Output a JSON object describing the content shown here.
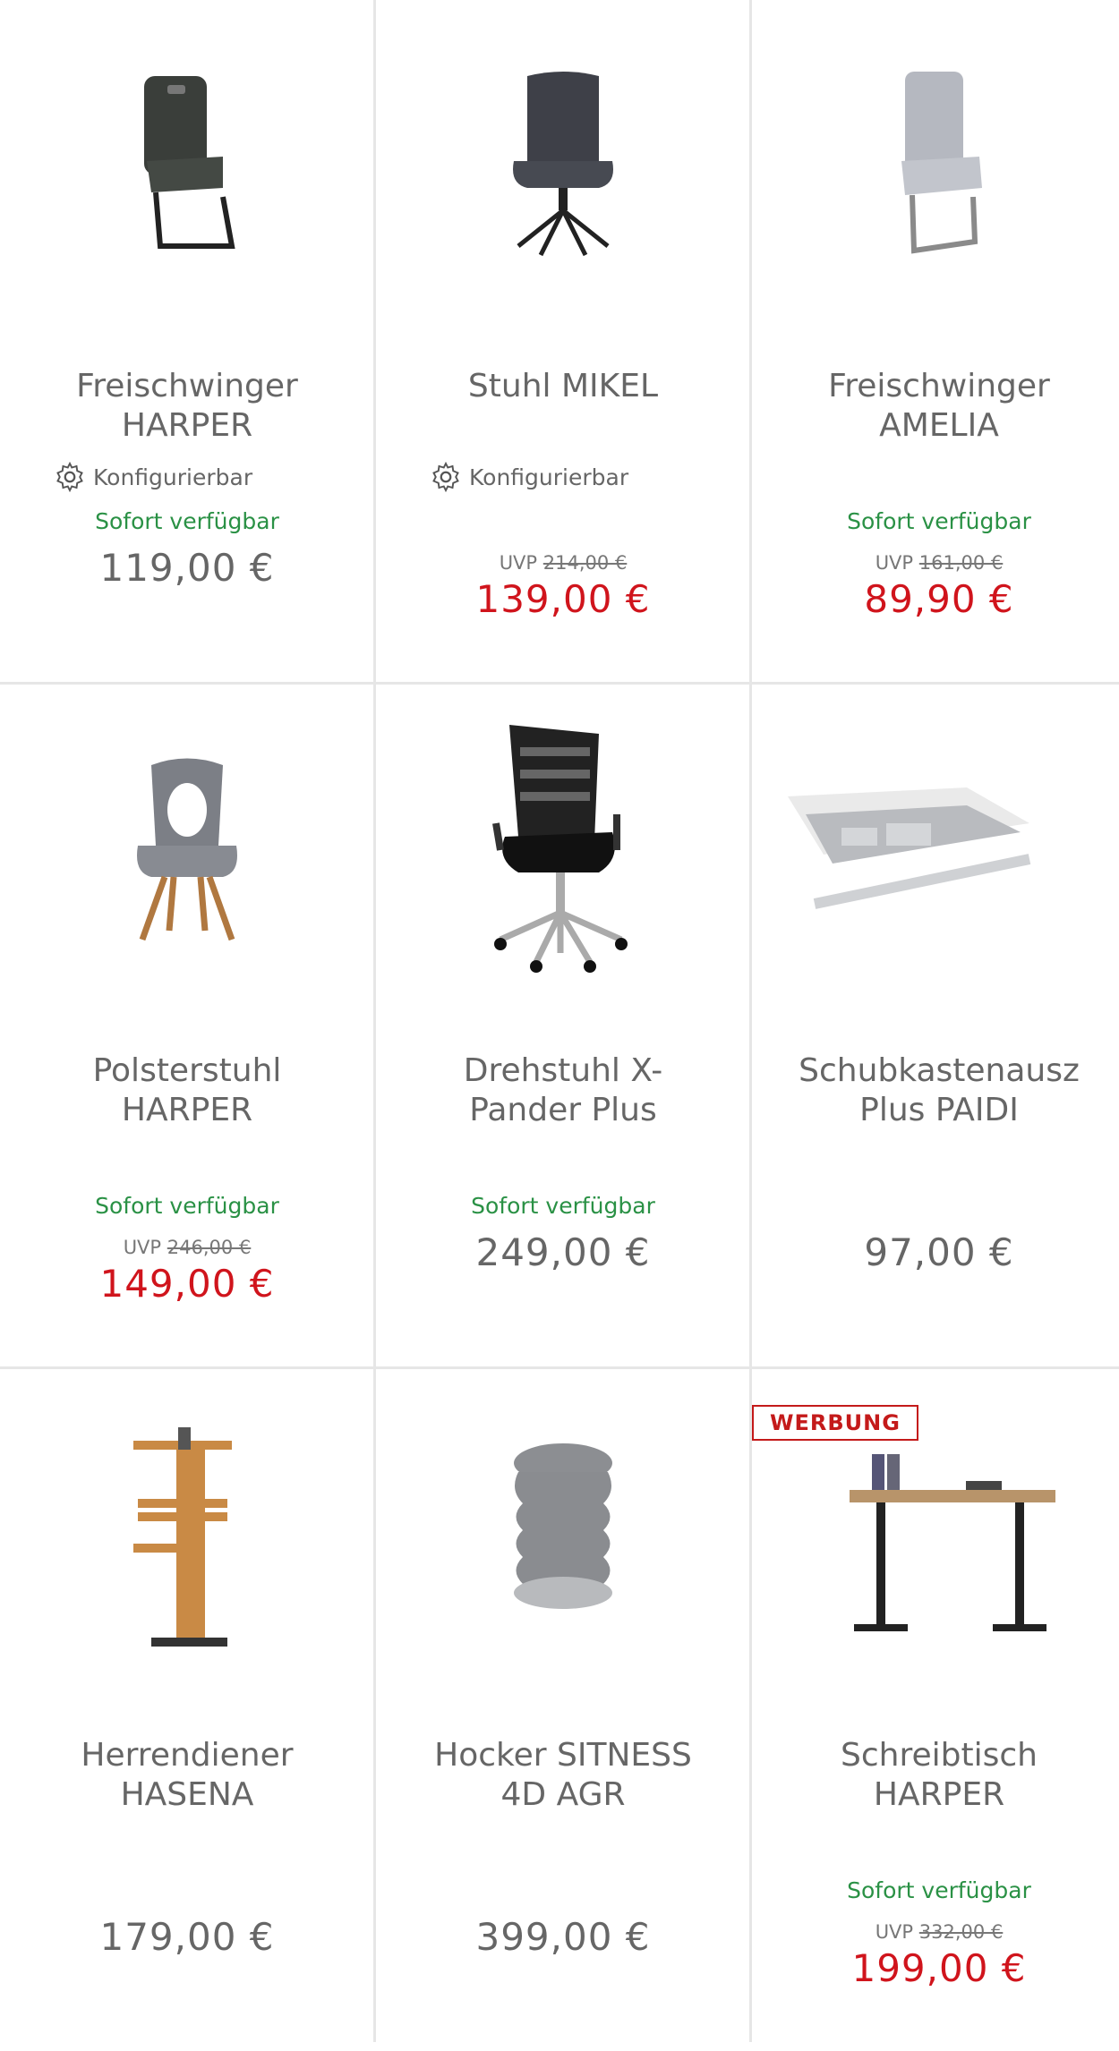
{
  "products": [
    {
      "name": "Freischwinger\nHARPER",
      "configurable": "Konfigurierbar",
      "availability": "Sofort verfügbar",
      "uvp_label": "",
      "uvp_price": "",
      "price": "119,00 €",
      "sale": false
    },
    {
      "name": "Stuhl MIKEL",
      "configurable": "Konfigurierbar",
      "availability": "",
      "uvp_label": "UVP",
      "uvp_price": "214,00 €",
      "price": "139,00 €",
      "sale": true
    },
    {
      "name": "Freischwinger\nAMELIA",
      "configurable": "",
      "availability": "Sofort verfügbar",
      "uvp_label": "UVP",
      "uvp_price": "161,00 €",
      "price": "89,90 €",
      "sale": true
    },
    {
      "name": "Polsterstuhl\nHARPER",
      "configurable": "",
      "availability": "Sofort verfügbar",
      "uvp_label": "UVP",
      "uvp_price": "246,00 €",
      "price": "149,00 €",
      "sale": true
    },
    {
      "name": "Drehstuhl X-\nPander Plus",
      "configurable": "",
      "availability": "Sofort verfügbar",
      "uvp_label": "",
      "uvp_price": "",
      "price": "249,00 €",
      "sale": false
    },
    {
      "name": "Schubkastenausz\nPlus PAIDI",
      "configurable": "",
      "availability": "",
      "uvp_label": "",
      "uvp_price": "",
      "price": "97,00 €",
      "sale": false
    },
    {
      "name": "Herrendiener\nHASENA",
      "configurable": "",
      "availability": "",
      "uvp_label": "",
      "uvp_price": "",
      "price": "179,00 €",
      "sale": false
    },
    {
      "name": "Hocker SITNESS\n4D AGR",
      "configurable": "",
      "availability": "",
      "uvp_label": "",
      "uvp_price": "",
      "price": "399,00 €",
      "sale": false
    },
    {
      "name": "Schreibtisch\nHARPER",
      "configurable": "",
      "availability": "Sofort verfügbar",
      "uvp_label": "UVP",
      "uvp_price": "332,00 €",
      "price": "199,00 €",
      "sale": true,
      "badge": "WERBUNG"
    }
  ],
  "colors": {
    "sale": "#d0141c",
    "available": "#2a9145",
    "text": "#666666",
    "badge": "#c41a1a"
  }
}
